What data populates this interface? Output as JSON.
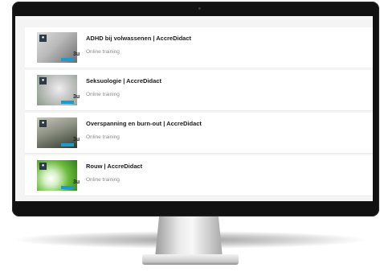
{
  "courses": [
    {
      "title": "ADHD bij volwassenen | AccreDidact",
      "subtitle": "Online training",
      "badge": "●",
      "duration": "3u"
    },
    {
      "title": "Seksuologie | AccreDidact",
      "subtitle": "Online training",
      "badge": "●",
      "duration": "3u"
    },
    {
      "title": "Overspanning en burn-out | AccreDidact",
      "subtitle": "Online training",
      "badge": "●",
      "duration": "3u"
    },
    {
      "title": "Rouw | AccreDidact",
      "subtitle": "Online training",
      "badge": "●",
      "duration": "3u"
    }
  ],
  "icons": {
    "badge": "play-badge-icon",
    "camera": "camera-dot-icon"
  },
  "colors": {
    "bezel": "#121213",
    "screen_bg": "#f4f4f4",
    "card_bg": "#ffffff",
    "title": "#1b1b1b",
    "subtitle": "#8a8a8a",
    "badge": "#2e3a46",
    "ribbon": "#1d9bd1"
  }
}
